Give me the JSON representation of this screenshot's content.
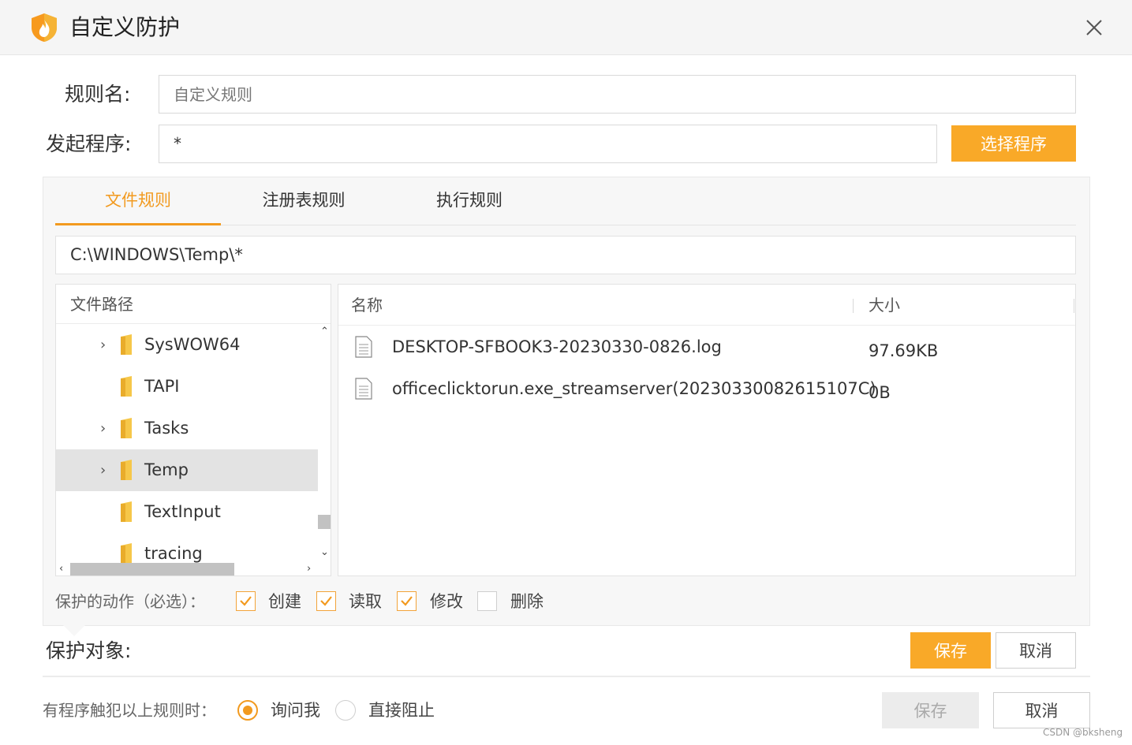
{
  "window": {
    "title": "自定义防护",
    "logo_icon": "flame-shield-icon",
    "close_icon": "close-icon",
    "accent": "#f9a928"
  },
  "rule_name": {
    "label": "规则名:",
    "placeholder": "自定义规则",
    "value": ""
  },
  "launcher": {
    "label": "发起程序:",
    "value": "*",
    "button": "选择程序"
  },
  "tabs": [
    {
      "label": "文件规则",
      "active": true
    },
    {
      "label": "注册表规则",
      "active": false
    },
    {
      "label": "执行规则",
      "active": false
    }
  ],
  "path": "C:\\WINDOWS\\Temp\\*",
  "tree": {
    "header": "文件路径",
    "items": [
      {
        "label": "SysWOW64",
        "expandable": true,
        "selected": false
      },
      {
        "label": "TAPI",
        "expandable": false,
        "selected": false
      },
      {
        "label": "Tasks",
        "expandable": true,
        "selected": false
      },
      {
        "label": "Temp",
        "expandable": true,
        "selected": true
      },
      {
        "label": "TextInput",
        "expandable": false,
        "selected": false
      },
      {
        "label": "tracing",
        "expandable": false,
        "selected": false
      }
    ]
  },
  "files": {
    "col_name": "名称",
    "col_size": "大小",
    "rows": [
      {
        "name": "DESKTOP-SFBOOK3-20230330-0826.log",
        "size": "97.69KB"
      },
      {
        "name": "officeclicktorun.exe_streamserver(20230330082615107C)",
        "size": "0B"
      }
    ]
  },
  "actions": {
    "label": "保护的动作（必选）：",
    "options": [
      {
        "label": "创建",
        "checked": true
      },
      {
        "label": "读取",
        "checked": true
      },
      {
        "label": "修改",
        "checked": true
      },
      {
        "label": "删除",
        "checked": false
      }
    ]
  },
  "protect_target": {
    "label": "保护对象:",
    "save": "保存",
    "cancel": "取消"
  },
  "trigger": {
    "label": "有程序触犯以上规则时：",
    "options": [
      {
        "label": "询问我",
        "selected": true
      },
      {
        "label": "直接阻止",
        "selected": false
      }
    ]
  },
  "footer": {
    "save": "保存",
    "cancel": "取消"
  },
  "watermark": "CSDN @bksheng"
}
